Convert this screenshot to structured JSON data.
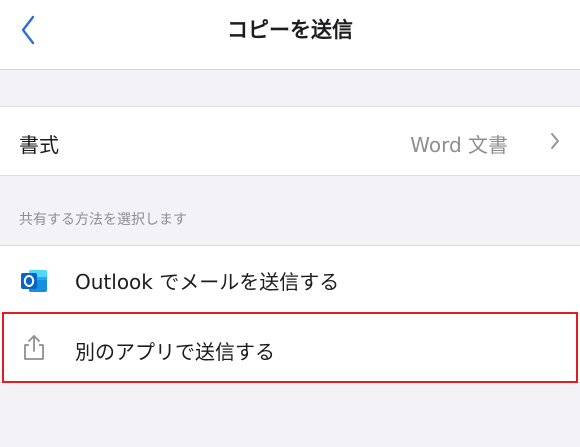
{
  "nav": {
    "title": "コピーを送信",
    "back_icon": "chevron-left-icon"
  },
  "format_row": {
    "label": "書式",
    "value": "Word 文書",
    "chevron_icon": "chevron-right-icon"
  },
  "section_header": "共有する方法を選択します",
  "options": [
    {
      "label": "Outlook でメールを送信する",
      "icon": "outlook-icon"
    },
    {
      "label": "別のアプリで送信する",
      "icon": "share-icon"
    }
  ],
  "colors": {
    "accent": "#2f6cd6",
    "outlook_blue": "#0a64c8",
    "highlight": "#e31b23",
    "background": "#f2f2f7"
  }
}
